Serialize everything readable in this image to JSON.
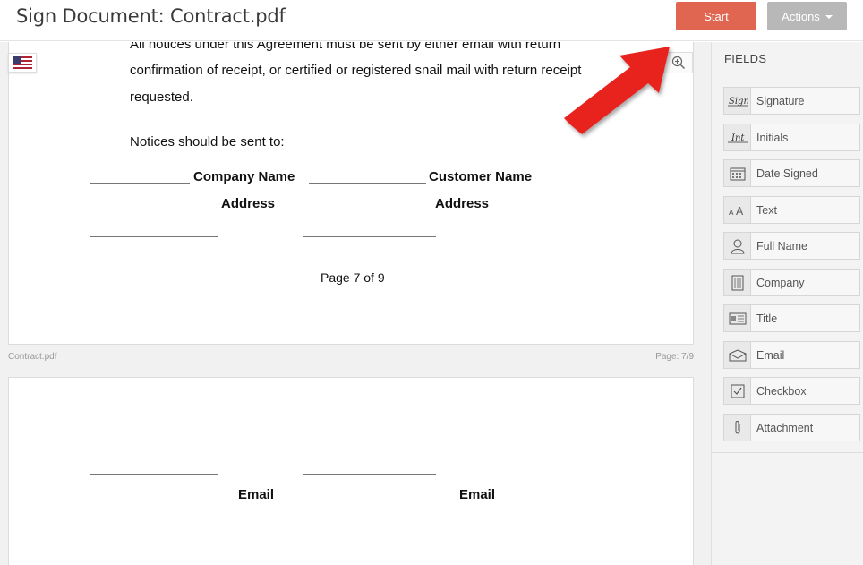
{
  "header": {
    "title": "Sign Document: Contract.pdf",
    "start_label": "Start",
    "actions_label": "Actions"
  },
  "document": {
    "page1": {
      "notice_line1": "All notices under this Agreement must be sent by either email with return",
      "notice_line2": "confirmation of receipt, or certified or registered snail mail with return receipt",
      "notice_line3": "requested.",
      "notices_sent_to": "Notices should be sent to:",
      "company_name_label": "Company Name",
      "customer_name_label": "Customer Name",
      "address_label_left": "Address",
      "address_label_right": "Address",
      "page_number": "Page 7 of 9"
    },
    "footer": {
      "filename": "Contract.pdf",
      "page_indicator": "Page: 7/9"
    },
    "page2": {
      "email_label_left": "Email",
      "email_label_right": "Email"
    }
  },
  "sidebar": {
    "heading": "FIELDS",
    "items": [
      {
        "label": "Signature",
        "icon": "signature-icon"
      },
      {
        "label": "Initials",
        "icon": "initials-icon"
      },
      {
        "label": "Date Signed",
        "icon": "calendar-icon"
      },
      {
        "label": "Text",
        "icon": "text-icon"
      },
      {
        "label": "Full Name",
        "icon": "person-icon"
      },
      {
        "label": "Company",
        "icon": "building-icon"
      },
      {
        "label": "Title",
        "icon": "id-card-icon"
      },
      {
        "label": "Email",
        "icon": "envelope-icon"
      },
      {
        "label": "Checkbox",
        "icon": "checkbox-icon"
      },
      {
        "label": "Attachment",
        "icon": "paperclip-icon"
      }
    ]
  },
  "colors": {
    "start_button": "#e06651",
    "actions_button": "#b8b8b8",
    "arrow": "#e8201c"
  }
}
